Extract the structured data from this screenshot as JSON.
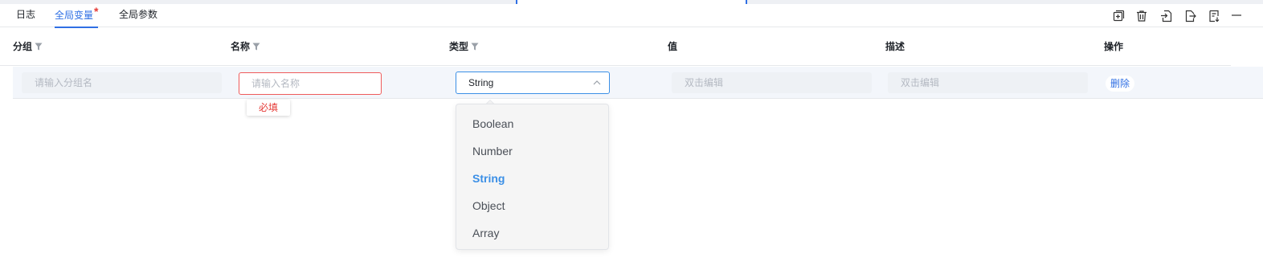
{
  "tabs": [
    {
      "label": "日志",
      "active": false
    },
    {
      "label": "全局变量",
      "active": true,
      "modified_marker": "*"
    },
    {
      "label": "全局参数",
      "active": false
    }
  ],
  "toolbar": {
    "icons": [
      "add-icon",
      "trash-icon",
      "import-icon",
      "export-icon",
      "document-icon",
      "minimize-icon"
    ]
  },
  "table": {
    "columns": [
      {
        "label": "分组",
        "filter": true
      },
      {
        "label": "名称",
        "filter": true
      },
      {
        "label": "类型",
        "filter": true
      },
      {
        "label": "值",
        "filter": false
      },
      {
        "label": "描述",
        "filter": false
      },
      {
        "label": "操作",
        "filter": false
      }
    ],
    "row": {
      "group": {
        "value": "",
        "placeholder": "请输入分组名"
      },
      "name": {
        "value": "",
        "placeholder": "请输入名称",
        "error": "必填"
      },
      "type": {
        "selected": "String"
      },
      "value": {
        "value": "",
        "placeholder": "双击编辑"
      },
      "description": {
        "value": "",
        "placeholder": "双击编辑"
      },
      "action": {
        "label": "删除"
      }
    }
  },
  "type_dropdown": {
    "open": true,
    "options": [
      "Boolean",
      "Number",
      "String",
      "Object",
      "Array"
    ],
    "selected": "String"
  },
  "colors": {
    "accent": "#2f6fe4",
    "error": "#e53935",
    "select_border": "#3b8fe6"
  }
}
